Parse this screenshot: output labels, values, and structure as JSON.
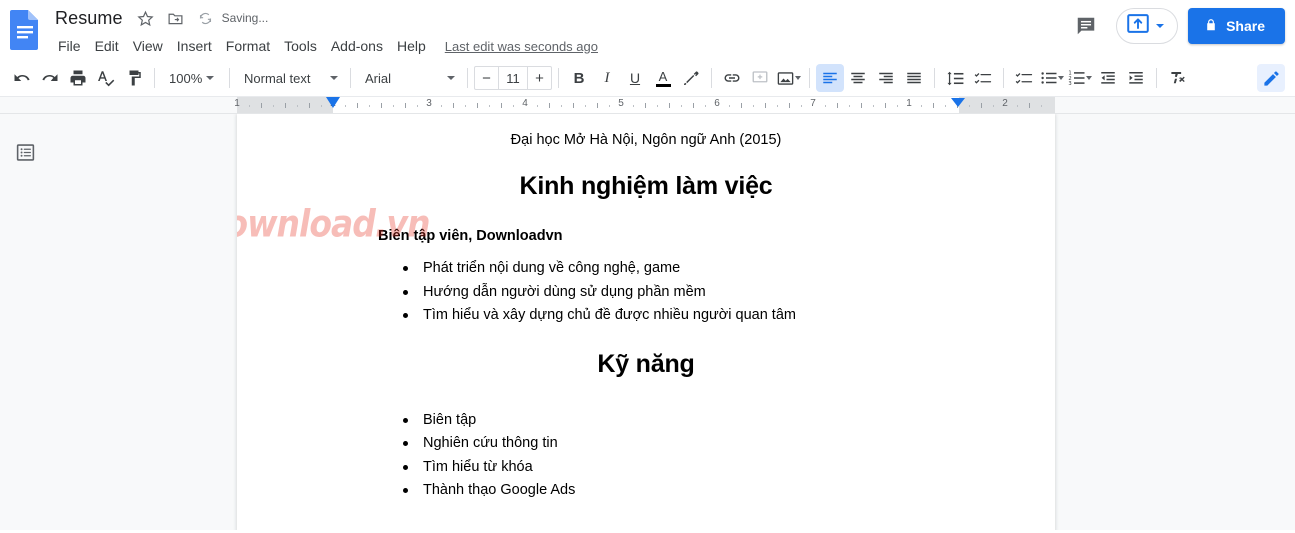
{
  "app": {
    "name": "Google Docs",
    "logo_icon": "google-docs-logo"
  },
  "header": {
    "doc_title": "Resume",
    "star_icon": "star-outline-icon",
    "move_icon": "move-to-folder-icon",
    "sync_icon": "sync-cloud-icon",
    "save_status": "Saving...",
    "last_edit": "Last edit was seconds ago",
    "menus": [
      {
        "label": "File"
      },
      {
        "label": "Edit"
      },
      {
        "label": "View"
      },
      {
        "label": "Insert"
      },
      {
        "label": "Format"
      },
      {
        "label": "Tools"
      },
      {
        "label": "Add-ons"
      },
      {
        "label": "Help"
      }
    ],
    "comment_history_icon": "comment-history-icon",
    "present_icon": "present-upload-icon",
    "share_label": "Share",
    "share_lock_icon": "lock-icon",
    "accent_color": "#1a73e8"
  },
  "toolbar": {
    "undo_icon": "undo-icon",
    "redo_icon": "redo-icon",
    "print_icon": "print-icon",
    "spellcheck_icon": "spellcheck-icon",
    "paint_format_icon": "paint-format-icon",
    "zoom_value": "100%",
    "paragraph_style": "Normal text",
    "font_family": "Arial",
    "font_size": "11",
    "font_size_decrease": "−",
    "font_size_increase": "+",
    "bold_label": "B",
    "italic_label": "I",
    "underline_label": "U",
    "text_color_label": "A",
    "text_color_value": "#000000",
    "highlight_icon": "highlight-pen-icon",
    "link_icon": "insert-link-icon",
    "comment_icon": "add-comment-icon",
    "image_icon": "insert-image-icon",
    "align_left_icon": "align-left-icon",
    "align_center_icon": "align-center-icon",
    "align_right_icon": "align-right-icon",
    "align_justify_icon": "align-justify-icon",
    "line_spacing_icon": "line-spacing-icon",
    "checklist_icon": "checklist-icon",
    "bulleted_list_icon": "bulleted-list-icon",
    "numbered_list_icon": "numbered-list-icon",
    "indent_decrease_icon": "indent-decrease-icon",
    "indent_increase_icon": "indent-increase-icon",
    "clear_formatting_icon": "clear-formatting-icon",
    "editing_mode_icon": "edit-pencil-icon",
    "active_alignment": "align-left"
  },
  "ruler": {
    "numbers": [
      "1",
      "2",
      "3",
      "4",
      "5",
      "6",
      "7"
    ],
    "left_indent_marker": "left-indent-marker",
    "right_indent_marker": "right-indent-marker"
  },
  "sidebar": {
    "outline_icon": "document-outline-icon"
  },
  "document": {
    "education_line": "Đại học Mở Hà Nội, Ngôn ngữ Anh (2015)",
    "experience_heading": "Kinh nghiệm làm việc",
    "job_title": "Biên tập viên, Downloadvn",
    "experience_bullets": [
      "Phát triển nội dung về công nghệ, game",
      "Hướng dẫn người dùng sử dụng phần mềm",
      "Tìm hiểu và xây dựng chủ đề được nhiều người quan tâm"
    ],
    "skills_heading": "Kỹ năng",
    "skills_bullets": [
      "Biên tập",
      "Nghiên cứu thông tin",
      "Tìm hiểu từ khóa",
      "Thành thạo Google Ads"
    ],
    "watermark_text": "Download.vn",
    "watermark_color": "#e8392a"
  }
}
